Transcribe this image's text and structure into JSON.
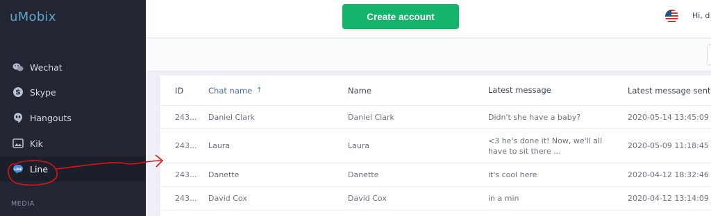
{
  "sidebar": {
    "logo": "uMobix",
    "items": [
      {
        "label": "Wechat",
        "icon": "wechat-icon"
      },
      {
        "label": "Skype",
        "icon": "skype-icon"
      },
      {
        "label": "Hangouts",
        "icon": "hangouts-icon"
      },
      {
        "label": "Kik",
        "icon": "kik-icon"
      },
      {
        "label": "Line",
        "icon": "line-icon",
        "active": true
      }
    ],
    "section_label": "MEDIA"
  },
  "header": {
    "create_button": "Create account",
    "greeting": "Hi, d"
  },
  "table": {
    "columns": [
      "ID",
      "Chat name",
      "Name",
      "Latest message",
      "Latest message sent"
    ],
    "sorted_column": "Chat name",
    "rows": [
      {
        "id": "243...",
        "chat_name": "Daniel Clark",
        "name": "Daniel Clark",
        "latest_message": "Didn't she have a baby?",
        "sent": "2020-05-14 13:45:09"
      },
      {
        "id": "243...",
        "chat_name": "Laura",
        "name": "Laura",
        "latest_message": "<3 he's done it! Now, we'll all have to sit there ...",
        "sent": "2020-05-09 11:18:45"
      },
      {
        "id": "243...",
        "chat_name": "Danette",
        "name": "Danette",
        "latest_message": "it's cool here",
        "sent": "2020-04-12 18:32:46"
      },
      {
        "id": "243...",
        "chat_name": "David Cox",
        "name": "David Cox",
        "latest_message": "in a min",
        "sent": "2020-04-12 13:14:09"
      }
    ]
  },
  "colors": {
    "sidebar_bg": "#222633",
    "accent_green": "#14b56a",
    "annotation_red": "#e0101a",
    "link_blue": "#4a6fb5"
  }
}
